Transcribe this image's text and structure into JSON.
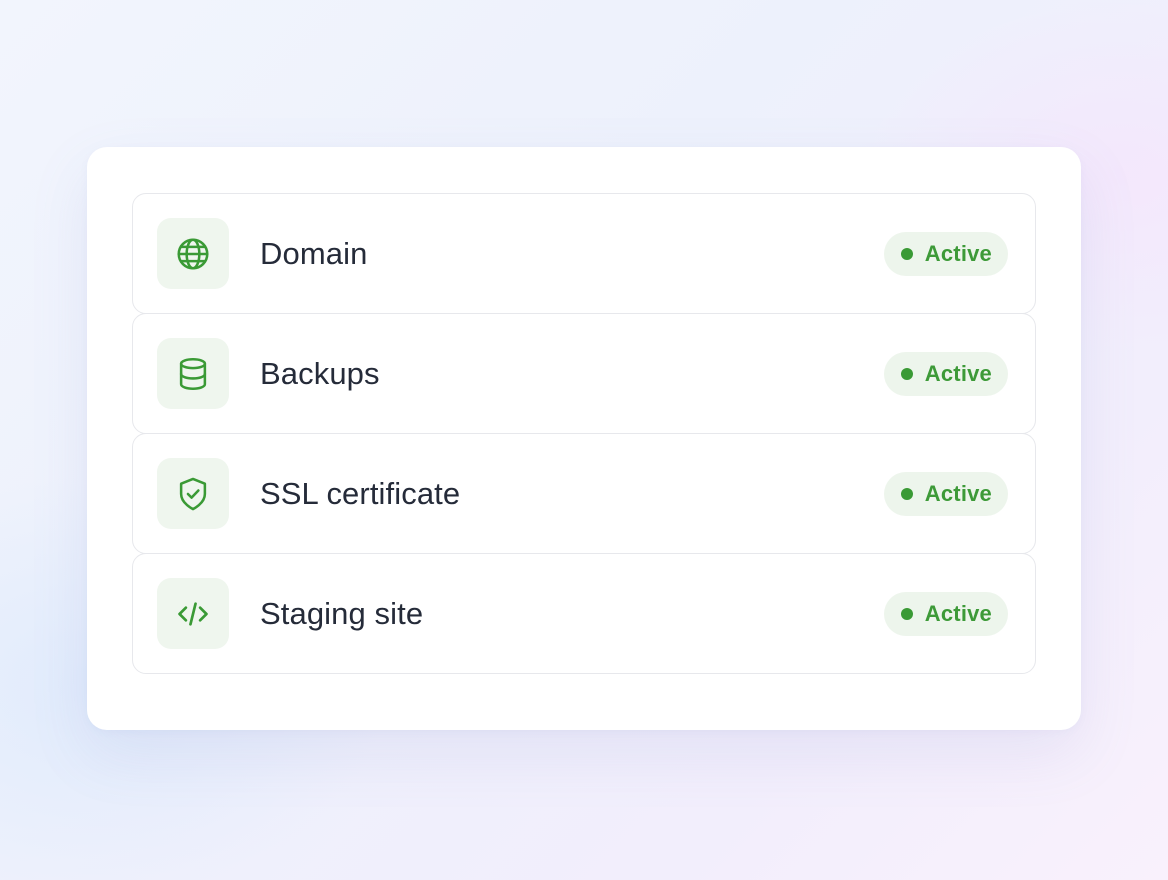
{
  "theme": {
    "accent": "#3a9a35",
    "badge_bg": "#edf5ec",
    "icon_bg": "#eff6ee",
    "text": "#252b39"
  },
  "services": [
    {
      "label": "Domain",
      "icon": "globe-icon",
      "status": "Active"
    },
    {
      "label": "Backups",
      "icon": "database-icon",
      "status": "Active"
    },
    {
      "label": "SSL certificate",
      "icon": "shield-check-icon",
      "status": "Active"
    },
    {
      "label": "Staging site",
      "icon": "code-icon",
      "status": "Active"
    }
  ]
}
